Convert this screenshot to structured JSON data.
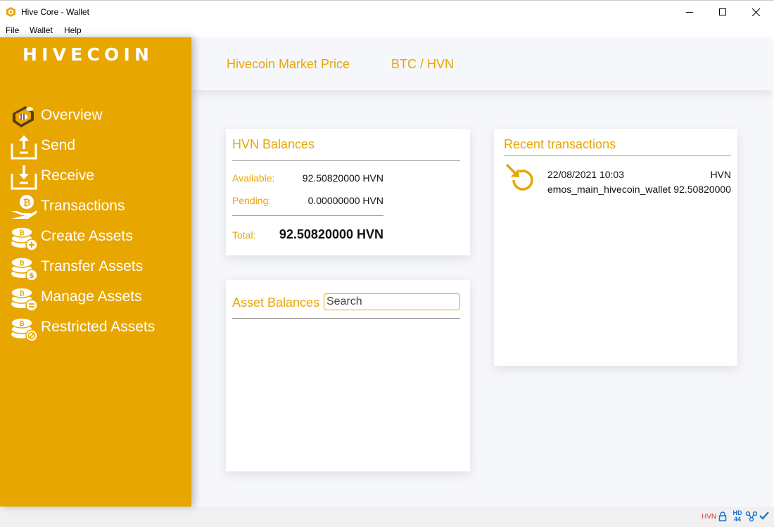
{
  "window": {
    "title": "Hive Core - Wallet",
    "icon": "hive-logo-icon"
  },
  "menu": {
    "items": [
      "File",
      "Wallet",
      "Help"
    ]
  },
  "sidebar": {
    "logo": "HIVECOIN",
    "items": [
      {
        "label": "Overview",
        "icon": "bee-hive-icon"
      },
      {
        "label": "Send",
        "icon": "upload-tray-icon"
      },
      {
        "label": "Receive",
        "icon": "download-tray-icon"
      },
      {
        "label": "Transactions",
        "icon": "coin-hand-icon"
      },
      {
        "label": "Create Assets",
        "icon": "coins-plus-icon"
      },
      {
        "label": "Transfer Assets",
        "icon": "coins-transfer-icon"
      },
      {
        "label": "Manage Assets",
        "icon": "coins-manage-icon"
      },
      {
        "label": "Restricted Assets",
        "icon": "coins-restricted-icon"
      }
    ]
  },
  "header": {
    "market_price_label": "Hivecoin Market Price",
    "pair_label": "BTC / HVN"
  },
  "balances": {
    "title": "HVN Balances",
    "available_label": "Available:",
    "available_value": "92.50820000 HVN",
    "pending_label": "Pending:",
    "pending_value": "0.00000000 HVN",
    "total_label": "Total:",
    "total_value": "92.50820000 HVN"
  },
  "assets": {
    "title": "Asset Balances",
    "search_placeholder": "Search"
  },
  "recent": {
    "title": "Recent transactions",
    "transactions": [
      {
        "date": "22/08/2021 10:03",
        "unit": "HVN",
        "wallet": "emos_main_hivecoin_wallet",
        "amount": "92.50820000",
        "icon": "incoming-arrow-icon"
      }
    ]
  },
  "status": {
    "unit": "HVN",
    "hd_label": "HD",
    "hd_sub": "44"
  },
  "colors": {
    "accent": "#e8a600",
    "sidebar_bg": "#e8a600",
    "main_bg": "#f6f7fb",
    "status_unit": "#e03030",
    "status_icon": "#1a6fd0"
  }
}
